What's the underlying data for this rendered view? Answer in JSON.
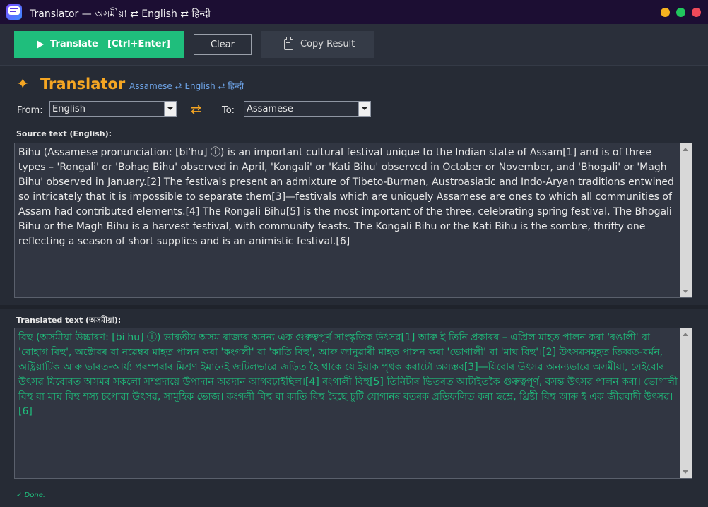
{
  "window": {
    "title": "Translator — অসমীয়া ⇄ English ⇄ हिन्दी",
    "controls": {
      "minimize_color": "#f5b21f",
      "maximize_color": "#21c55d",
      "close_color": "#f04a5a"
    }
  },
  "toolbar": {
    "translate_label": "Translate",
    "translate_shortcut": "[Ctrl+Enter]",
    "clear_label": "Clear",
    "copy_label": "Copy Result"
  },
  "header": {
    "star": "✦",
    "title": "Translator",
    "languages": "Assamese ⇄ English ⇄ हिन्दी"
  },
  "lang_select": {
    "from_label": "From:",
    "from_value": "English",
    "swap_symbol": "⇄",
    "to_label": "To:",
    "to_value": "Assamese"
  },
  "source": {
    "label": "Source text (English):",
    "text": "Bihu (Assamese pronunciation: [biˈhu] ⓘ) is an important cultural festival unique to the Indian state of Assam[1] and is of three types – 'Rongali' or 'Bohag Bihu' observed in April, 'Kongali' or 'Kati Bihu' observed in October or November, and 'Bhogali' or 'Magh Bihu' observed in January.[2] The festivals present an admixture of Tibeto-Burman, Austroasiatic and Indo-Aryan traditions entwined so intricately that it is impossible to separate them[3]—festivals which are uniquely Assamese are ones to which all communities of Assam had contributed elements.[4] The Rongali Bihu[5] is the most important of the three, celebrating spring festival. The Bhogali Bihu or the Magh Bihu is a harvest festival, with community feasts. The Kongali Bihu or the Kati Bihu is the sombre, thrifty one reflecting a season of short supplies and is an animistic festival.[6]"
  },
  "translated": {
    "label": "Translated text (অসমীয়া):",
    "text": "বিহু (অসমীয়া উচ্চাৰণ: [biˈhu] ⓘ) ভাৰতীয় অসম ৰাজ্যৰ অনন্য এক গুৰুত্বপূৰ্ণ সাংস্কৃতিক উৎসৱ[1] আৰু ই তিনি প্ৰকাৰৰ – এপ্ৰিল মাহত পালন কৰা 'ৰঙালী' বা 'বোহাগ বিহু', অক্টোবৰ বা নৱেম্বৰ মাহত পালন কৰা 'কংগলী' বা 'কাতি বিহু', আৰু জানুৱাৰী মাহত পালন কৰা 'ভোগালী' বা 'মাঘ বিহু'।[2] উৎসৱসমূহত তিব্বত-বৰ্মন, অষ্ট্ৰিয়াটিক আৰু ভাৰত-আৰ্য্য পৰম্পৰাৰ মিশ্ৰণ ইমানেই জটিলভাৱে জড়িত হৈ থাকে যে ইয়াক পৃথক কৰাটো অসম্ভব[3]—যিবোৰ উৎসৱ অনন্যভাৱে অসমীয়া, সেইবোৰ উৎসৱ যিবোৰত অসমৰ সকলো সম্প্ৰদায়ে উপাদান অৱদান আগবঢ়াইছিল।[4] ৰংগালী বিহু[5] তিনিটাৰ ভিতৰত আটাইতকৈ গুৰুত্বপূৰ্ণ, বসন্ত উৎসৱ পালন কৰা। ভোগালী বিহু বা মাঘ বিহু শস্য চপোৱা উৎসৱ, সামূহিক ভোজ। কংগলী বিহু বা কাতি বিহু হৈছে চুটি যোগানৰ বতৰক প্ৰতিফলিত কৰা ছম্ৰে, থ্ৰিষ্টী বিহু আৰু ই এক জীৱবাদী উৎসৱ।[6]"
  },
  "status": {
    "text": "✓ Done."
  },
  "colors": {
    "accent_green": "#1fbe7c",
    "accent_orange": "#f5a623",
    "link_blue": "#6ea4e8"
  }
}
